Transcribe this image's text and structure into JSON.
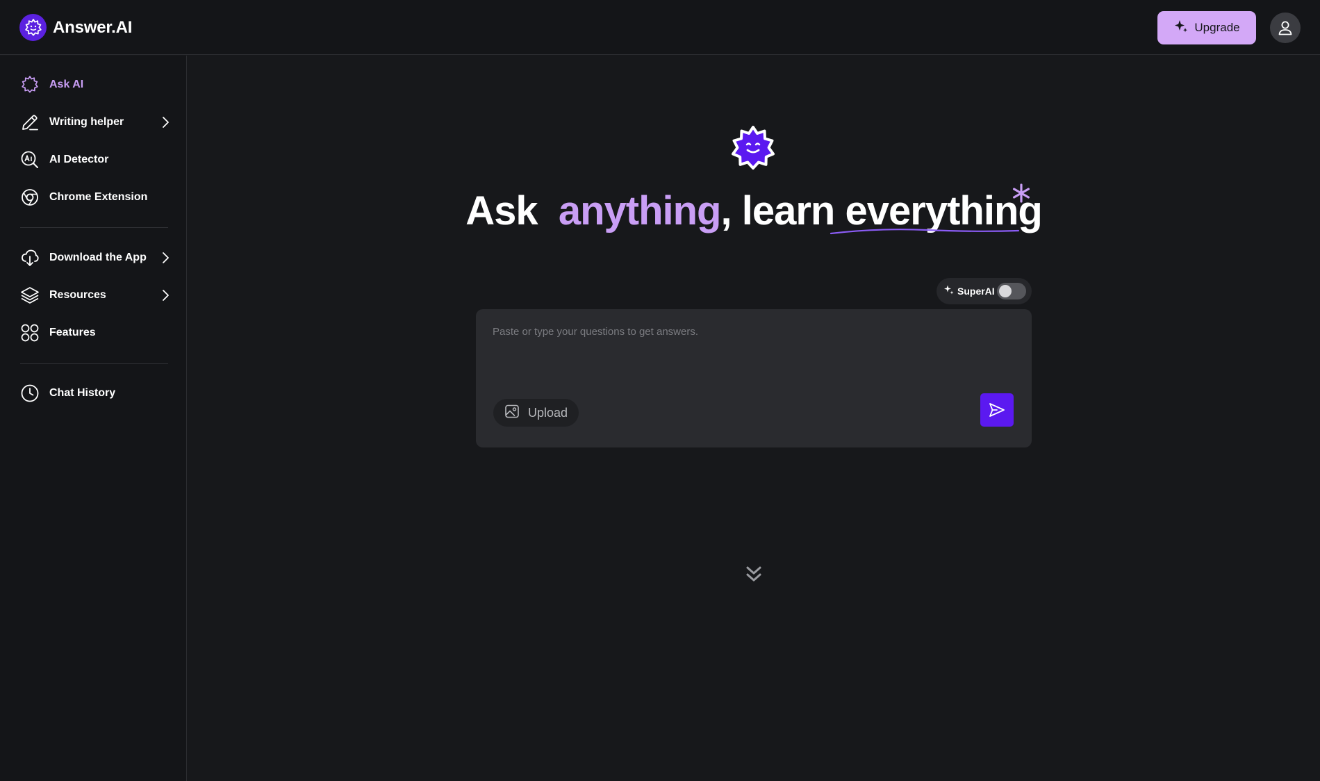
{
  "header": {
    "brand_name": "Answer.AI",
    "upgrade_label": "Upgrade"
  },
  "sidebar": {
    "items": [
      {
        "label": "Ask AI",
        "icon": "badge-icon",
        "active": true
      },
      {
        "label": "Writing helper",
        "icon": "pencil-icon",
        "has_submenu": true
      },
      {
        "label": "AI Detector",
        "icon": "ai-detector-icon"
      },
      {
        "label": "Chrome Extension",
        "icon": "chrome-icon"
      },
      {
        "label": "Download the App",
        "icon": "cloud-download-icon",
        "has_submenu": true
      },
      {
        "label": "Resources",
        "icon": "layers-icon",
        "has_submenu": true
      },
      {
        "label": "Features",
        "icon": "grid-circles-icon"
      },
      {
        "label": "Chat History",
        "icon": "clock-icon"
      }
    ]
  },
  "hero": {
    "headline_part1": "Ask",
    "headline_accent": "anything",
    "headline_part2": ", learn ",
    "headline_part3": "everything"
  },
  "composer": {
    "superai_label": "SuperAI",
    "superai_enabled": false,
    "placeholder": "Paste or type your questions to get answers.",
    "upload_label": "Upload"
  },
  "colors": {
    "background": "#17181b",
    "accent": "#c99ef5",
    "primary": "#5b19f0",
    "upgrade": "#d3a8f7"
  }
}
